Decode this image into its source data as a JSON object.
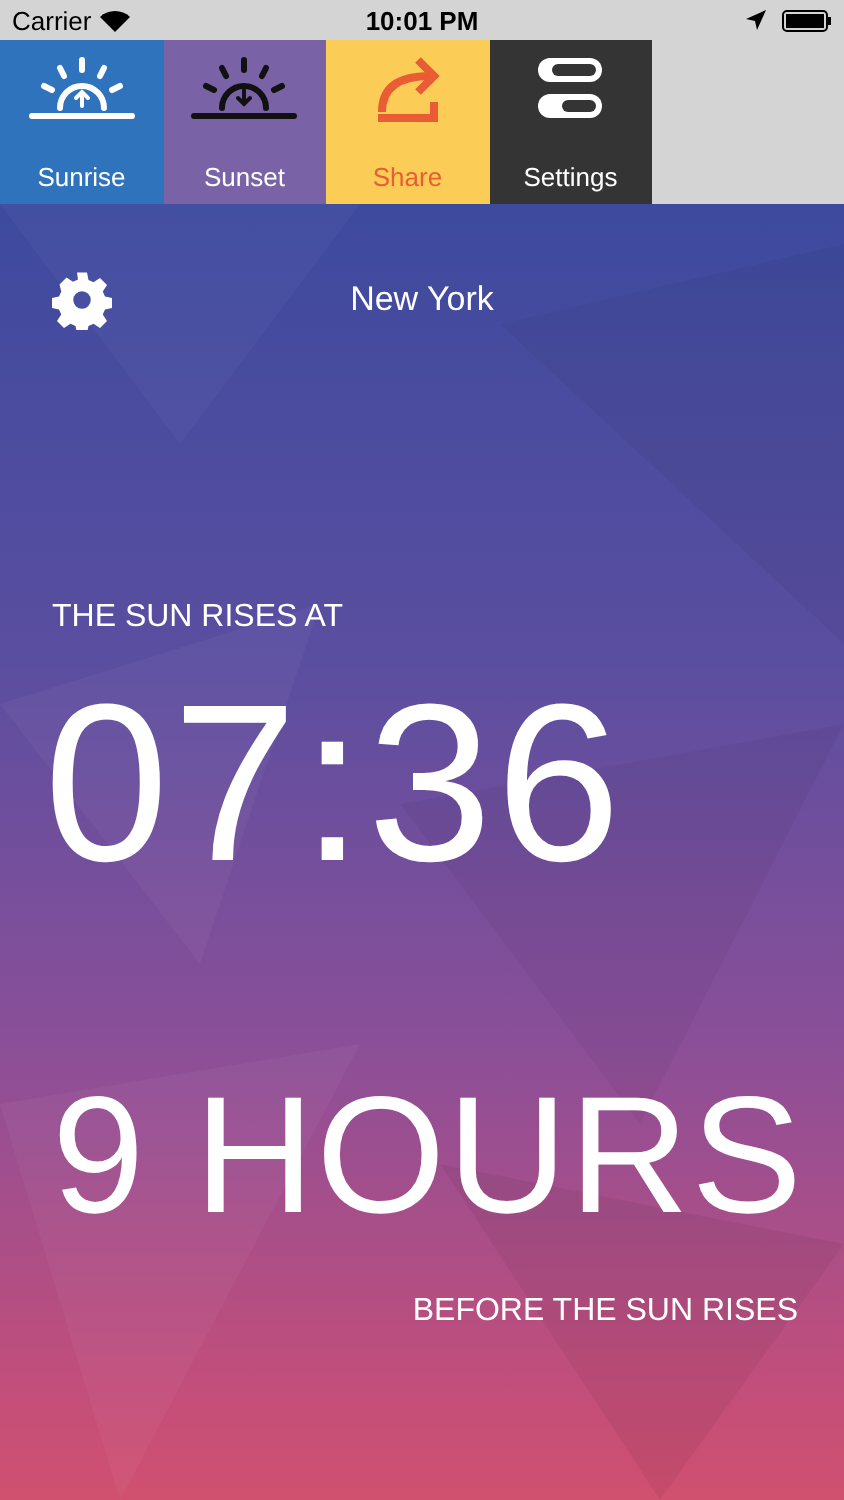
{
  "status_bar": {
    "carrier": "Carrier",
    "time": "10:01 PM"
  },
  "tabs": [
    {
      "label": "Sunrise",
      "kind": "sunrise",
      "color": "#2f73bd"
    },
    {
      "label": "Sunset",
      "kind": "sunset",
      "color": "#7a62a6"
    },
    {
      "label": "Share",
      "kind": "share",
      "color": "#fbcd57"
    },
    {
      "label": "Settings",
      "kind": "settings",
      "color": "#343434"
    }
  ],
  "location": "New York",
  "caption": "THE SUN RISES AT",
  "time": "07:36",
  "countdown": "9 HOURS",
  "countdown_caption": "BEFORE THE SUN RISES"
}
